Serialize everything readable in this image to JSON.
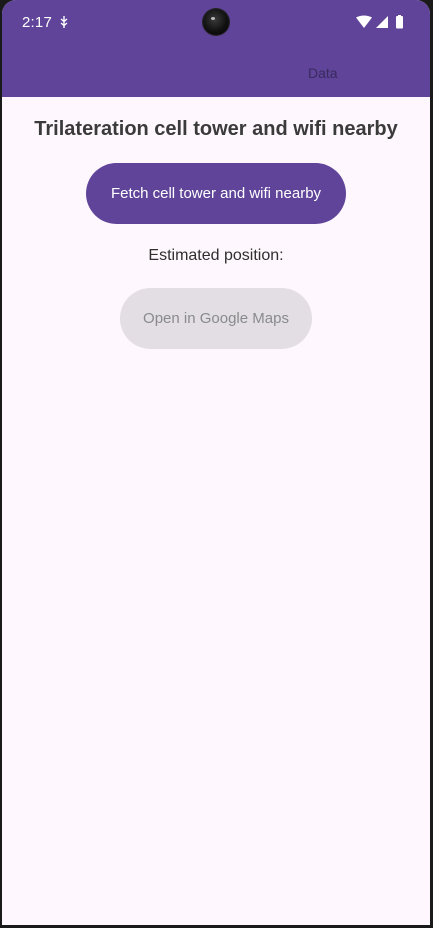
{
  "status_bar": {
    "time": "2:17",
    "icons": [
      "usb-debug-icon",
      "wifi-icon",
      "cell-signal-icon",
      "battery-icon"
    ]
  },
  "app_bar": {
    "tab_label": "Data",
    "color": "#5f4499"
  },
  "main": {
    "title": "Trilateration cell tower and wifi nearby",
    "fetch_button_label": "Fetch cell tower and wifi nearby",
    "estimated_label": "Estimated position:",
    "maps_button_label": "Open in Google Maps"
  },
  "colors": {
    "primary": "#5f4499",
    "background": "#fef7fd",
    "disabled_button": "#e2dee3"
  }
}
